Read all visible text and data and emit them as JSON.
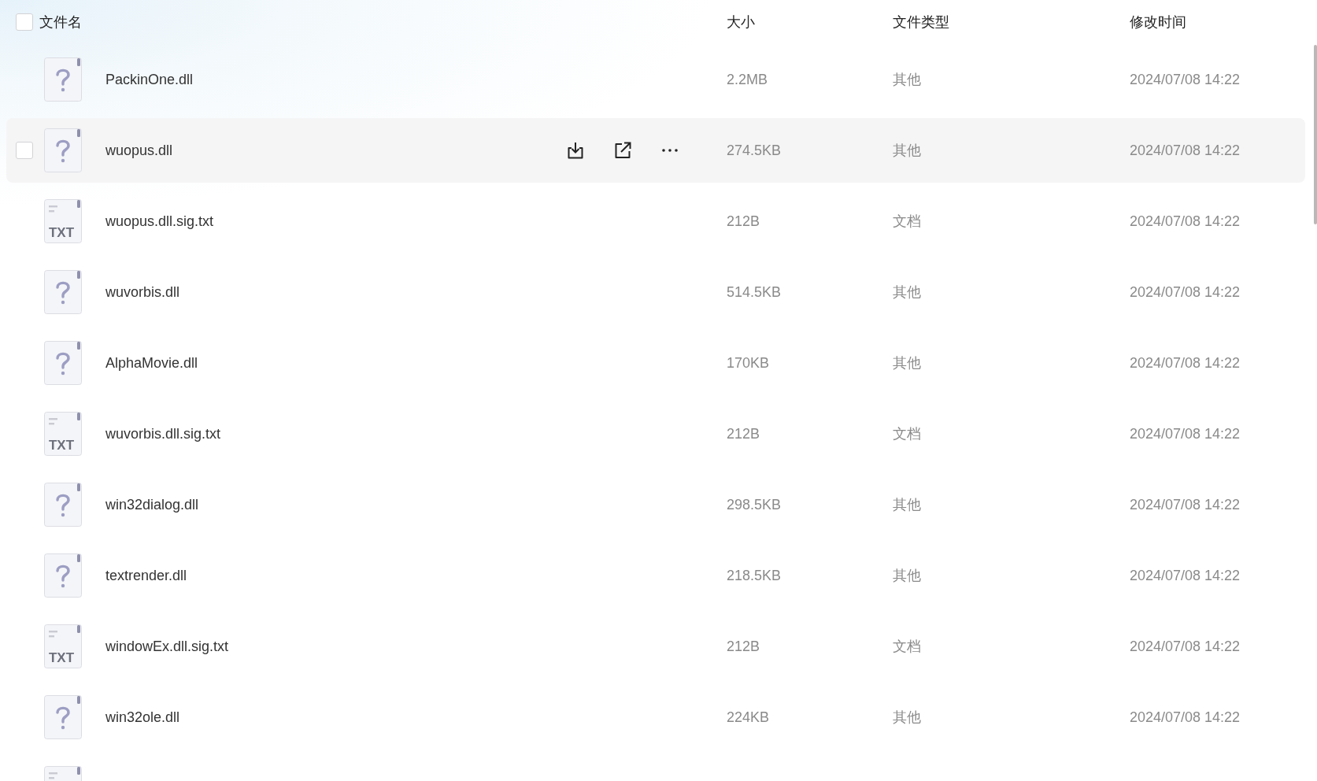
{
  "header": {
    "select_all": {
      "checked": false
    },
    "columns": [
      "文件名",
      "大小",
      "文件类型",
      "修改时间"
    ]
  },
  "files": [
    {
      "kind": "unknown",
      "name": "PackinOne.dll",
      "size": "2.2MB",
      "type": "其他",
      "modified": "2024/07/08 14:22",
      "hovered": false,
      "checked": false
    },
    {
      "kind": "unknown",
      "name": "wuopus.dll",
      "size": "274.5KB",
      "type": "其他",
      "modified": "2024/07/08 14:22",
      "hovered": true,
      "checked": false
    },
    {
      "kind": "txt",
      "icon_label": "TXT",
      "name": "wuopus.dll.sig.txt",
      "size": "212B",
      "type": "文档",
      "modified": "2024/07/08 14:22",
      "hovered": false,
      "checked": false
    },
    {
      "kind": "unknown",
      "name": "wuvorbis.dll",
      "size": "514.5KB",
      "type": "其他",
      "modified": "2024/07/08 14:22",
      "hovered": false,
      "checked": false
    },
    {
      "kind": "unknown",
      "name": "AlphaMovie.dll",
      "size": "170KB",
      "type": "其他",
      "modified": "2024/07/08 14:22",
      "hovered": false,
      "checked": false
    },
    {
      "kind": "txt",
      "icon_label": "TXT",
      "name": "wuvorbis.dll.sig.txt",
      "size": "212B",
      "type": "文档",
      "modified": "2024/07/08 14:22",
      "hovered": false,
      "checked": false
    },
    {
      "kind": "unknown",
      "name": "win32dialog.dll",
      "size": "298.5KB",
      "type": "其他",
      "modified": "2024/07/08 14:22",
      "hovered": false,
      "checked": false
    },
    {
      "kind": "unknown",
      "name": "textrender.dll",
      "size": "218.5KB",
      "type": "其他",
      "modified": "2024/07/08 14:22",
      "hovered": false,
      "checked": false
    },
    {
      "kind": "txt",
      "icon_label": "TXT",
      "name": "windowEx.dll.sig.txt",
      "size": "212B",
      "type": "文档",
      "modified": "2024/07/08 14:22",
      "hovered": false,
      "checked": false
    },
    {
      "kind": "unknown",
      "name": "win32ole.dll",
      "size": "224KB",
      "type": "其他",
      "modified": "2024/07/08 14:22",
      "hovered": false,
      "checked": false
    },
    {
      "kind": "txt",
      "hovered": false,
      "checked": false
    }
  ]
}
